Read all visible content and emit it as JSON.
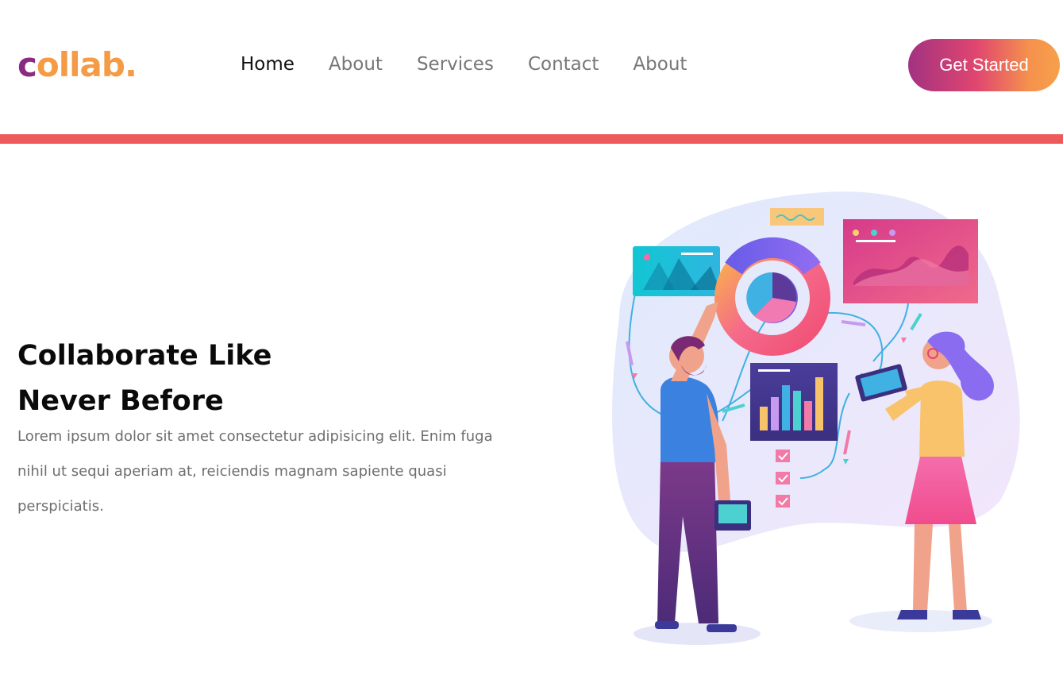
{
  "logo": {
    "first": "c",
    "rest": "ollab."
  },
  "nav": {
    "items": [
      {
        "label": "Home",
        "active": true
      },
      {
        "label": "About",
        "active": false
      },
      {
        "label": "Services",
        "active": false
      },
      {
        "label": "Contact",
        "active": false
      },
      {
        "label": "About",
        "active": false
      }
    ]
  },
  "cta": {
    "label": "Get Started"
  },
  "hero": {
    "title_line1": "Collaborate Like",
    "title_line2": "Never Before",
    "description": "Lorem ipsum dolor sit amet consectetur adipisicing elit. Enim fuga nihil ut sequi aperiam at, reiciendis magnam sapiente quasi perspiciatis."
  },
  "colors": {
    "logo_c": "#8a2a80",
    "logo_rest": "#f59a45",
    "divider": "#ee5a5a",
    "cta_start": "#a23281",
    "cta_end": "#f7a04b"
  },
  "illustration": {
    "icon": "team-analytics-illustration"
  }
}
